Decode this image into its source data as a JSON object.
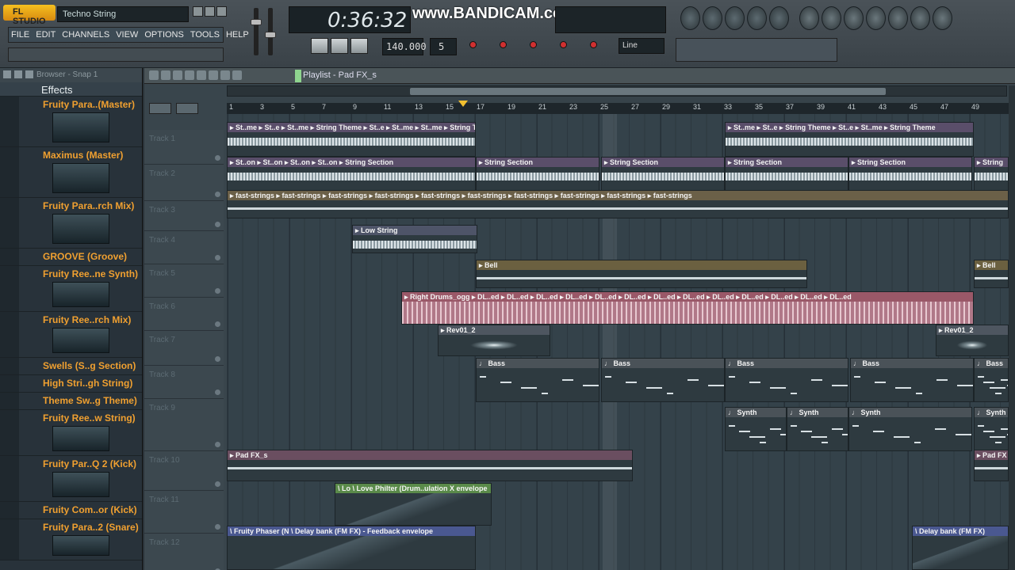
{
  "app": {
    "hint_text": "Techno String",
    "logo_label": "FL STUDIO",
    "menu": [
      "FILE",
      "EDIT",
      "CHANNELS",
      "VIEW",
      "OPTIONS",
      "TOOLS",
      "HELP"
    ],
    "time_display": "0:36:32",
    "watermark": "www.BANDICAM.com",
    "tempo": "140.000",
    "pattern": "5",
    "snap_label": "Line"
  },
  "browser": {
    "title": "Browser - Snap 1",
    "section_label": "Effects",
    "items": [
      {
        "label": "Fruity Para..(Master)",
        "has_thumb": true
      },
      {
        "label": "Maximus (Master)",
        "has_thumb": true
      },
      {
        "label": "Fruity Para..rch Mix)",
        "has_thumb": true
      },
      {
        "label": "GROOVE (Groove)",
        "has_thumb": false
      },
      {
        "label": "Fruity Ree..ne Synth)",
        "has_thumb": true
      },
      {
        "label": "Fruity Ree..rch Mix)",
        "has_thumb": true
      },
      {
        "label": "Swells (S..g Section)",
        "has_thumb": false
      },
      {
        "label": "High Stri..gh String)",
        "has_thumb": false
      },
      {
        "label": "Theme Sw..g Theme)",
        "has_thumb": false
      },
      {
        "label": "Fruity Ree..w String)",
        "has_thumb": true
      },
      {
        "label": "Fruity Par..Q 2 (Kick)",
        "has_thumb": true
      },
      {
        "label": "Fruity Com..or (Kick)",
        "has_thumb": false
      },
      {
        "label": "Fruity Para..2 (Snare)",
        "has_thumb": true
      }
    ]
  },
  "playlist": {
    "title": "Playlist - Pad FX_s",
    "ruler_labels": [
      "1",
      "3",
      "5",
      "7",
      "9",
      "11",
      "13",
      "15",
      "17",
      "19",
      "21",
      "23",
      "25",
      "27",
      "29",
      "31",
      "33",
      "35",
      "37",
      "39",
      "41",
      "43",
      "45",
      "47",
      "49"
    ],
    "tracks": [
      "Track 1",
      "Track 2",
      "Track 3",
      "Track 4",
      "Track 5",
      "Track 6",
      "Track 7",
      "Track 8",
      "Track 9",
      "Track 10",
      "Track 11",
      "Track 12"
    ],
    "clips": [
      {
        "label": "▸ St..me ▸ St..e ▸ St..me ▸ String Theme ▸ St..e ▸ St..me ▸ St..me ▸ String Theme",
        "color": "#5a4e6a"
      },
      {
        "label": "▸ St..me ▸ St..e ▸ String Theme ▸ St..e ▸ St..me ▸ String Theme",
        "color": "#5a4e6a"
      },
      {
        "label": "▸ St..on ▸ St..on ▸ St..on ▸ St..on ▸ String Section",
        "color": "#5a4e6a"
      },
      {
        "label": "▸ String Section",
        "color": "#5a4e6a"
      },
      {
        "label": "▸ String Section",
        "color": "#5a4e6a"
      },
      {
        "label": "▸ String Section",
        "color": "#5a4e6a"
      },
      {
        "label": "▸ String Section",
        "color": "#5a4e6a"
      },
      {
        "label": "▸ String",
        "color": "#5a4e6a"
      },
      {
        "label": "▸ fast-strings ▸ fast-strings ▸ fast-strings ▸ fast-strings ▸ fast-strings ▸ fast-strings ▸ fast-strings ▸ fast-strings ▸ fast-strings ▸ fast-strings",
        "color": "#6b6048"
      },
      {
        "label": "▸ Low String",
        "color": "#4e5468"
      },
      {
        "label": "▸ Bell",
        "color": "#6b6040"
      },
      {
        "label": "▸ Bell",
        "color": "#6b6040"
      },
      {
        "label": "▸ Right Drums_ogg ▸ DL..ed ▸ DL..ed ▸ DL..ed ▸ DL..ed ▸ DL..ed ▸ DL..ed ▸ DL..ed ▸ DL..ed ▸ DL..ed ▸ DL..ed ▸ DL..ed ▸ DL..ed ▸ DL..ed",
        "color": "#9a5868"
      },
      {
        "label": "▸ Rev01_2",
        "color": "#4e5660"
      },
      {
        "label": "▸ Rev01_2",
        "color": "#4e5660"
      },
      {
        "label": "♩ Bass",
        "color": "#4a5258"
      },
      {
        "label": "♩ Bass",
        "color": "#4a5258"
      },
      {
        "label": "♩ Bass",
        "color": "#4a5258"
      },
      {
        "label": "♩ Bass",
        "color": "#4a5258"
      },
      {
        "label": "♩ Bass",
        "color": "#4a5258"
      },
      {
        "label": "♩ Synth",
        "color": "#4a5258"
      },
      {
        "label": "♩ Synth",
        "color": "#4a5258"
      },
      {
        "label": "♩ Synth",
        "color": "#4a5258"
      },
      {
        "label": "♩ Synth",
        "color": "#4a5258"
      },
      {
        "label": "▸ Pad FX_s",
        "color": "#6a4e60"
      },
      {
        "label": "▸ Pad FX",
        "color": "#6a4e60"
      },
      {
        "label": "\\ Lo \\ Love Philter (Drum..ulation X envelope",
        "color": "#5a8a4a"
      },
      {
        "label": "\\ Fruity Phaser (N \\ Delay bank (FM FX) - Feedback envelope",
        "color": "#4a5890"
      },
      {
        "label": "\\ Delay bank (FM FX)",
        "color": "#4a5890"
      }
    ]
  }
}
